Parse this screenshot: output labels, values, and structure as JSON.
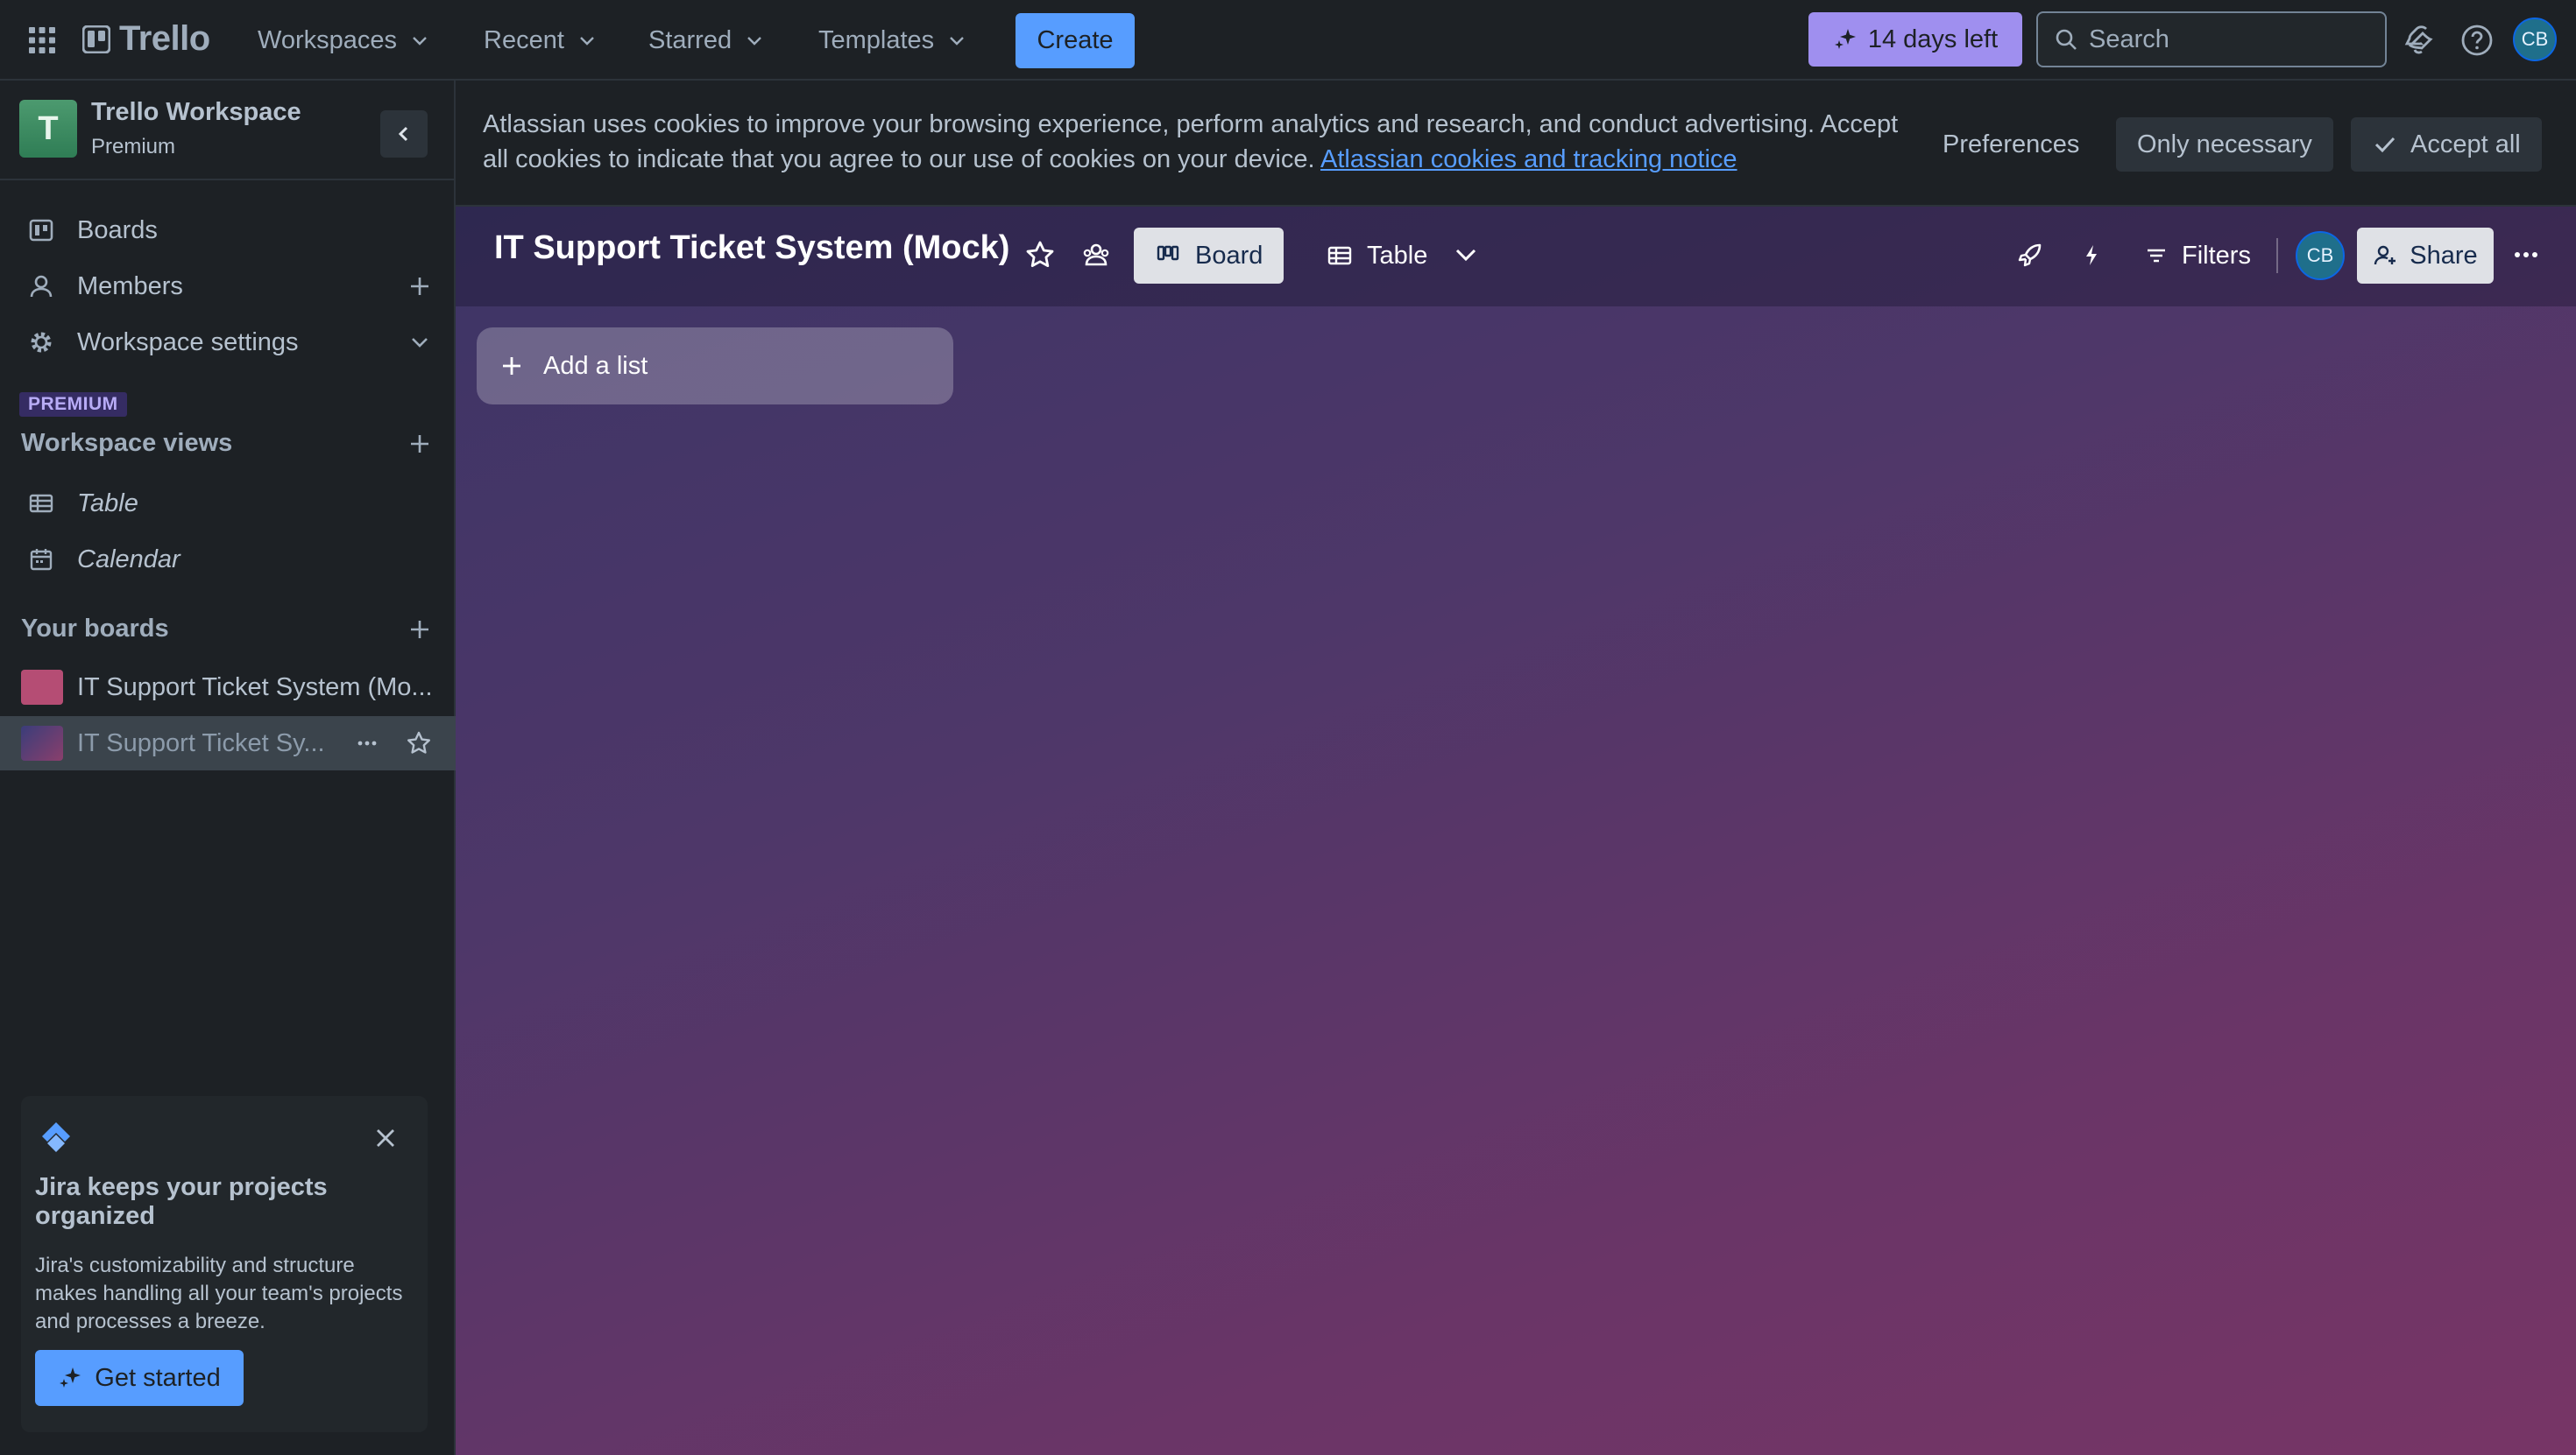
{
  "topbar": {
    "brand": "Trello",
    "menus": [
      "Workspaces",
      "Recent",
      "Starred",
      "Templates"
    ],
    "create_label": "Create",
    "trial_label": "14 days left",
    "search_placeholder": "Search",
    "avatar_initials": "CB"
  },
  "sidebar": {
    "workspace_initial": "T",
    "workspace_name": "Trello Workspace",
    "workspace_plan": "Premium",
    "nav": {
      "boards": "Boards",
      "members": "Members",
      "settings": "Workspace settings"
    },
    "premium_badge": "PREMIUM",
    "views_heading": "Workspace views",
    "views": [
      "Table",
      "Calendar"
    ],
    "boards_heading": "Your boards",
    "boards": [
      {
        "name": "IT Support Ticket System (Mo...",
        "color": "#b54d74"
      },
      {
        "name": "IT Support Ticket Sy...",
        "color": "#4b3f7a"
      }
    ],
    "jira": {
      "title": "Jira keeps your projects organized",
      "body": "Jira's customizability and structure makes handling all your team's projects and processes a breeze.",
      "button": "Get started"
    }
  },
  "cookie_banner": {
    "text": "Atlassian uses cookies to improve your browsing experience, perform analytics and research, and conduct advertising. Accept all cookies to indicate that you agree to our use of cookies on your device.",
    "link": "Atlassian cookies and tracking notice",
    "preferences": "Preferences",
    "only_necessary": "Only necessary",
    "accept_all": "Accept all"
  },
  "board": {
    "title": "IT Support Ticket System (Mock)",
    "tabs": {
      "board": "Board",
      "table": "Table"
    },
    "filters": "Filters",
    "avatar_initials": "CB",
    "share": "Share",
    "add_list": "Add a list"
  },
  "colors": {
    "accent_blue": "#579dff",
    "trial_purple": "#9f8fef",
    "background_start": "#3a3465",
    "background_end": "#773566"
  }
}
